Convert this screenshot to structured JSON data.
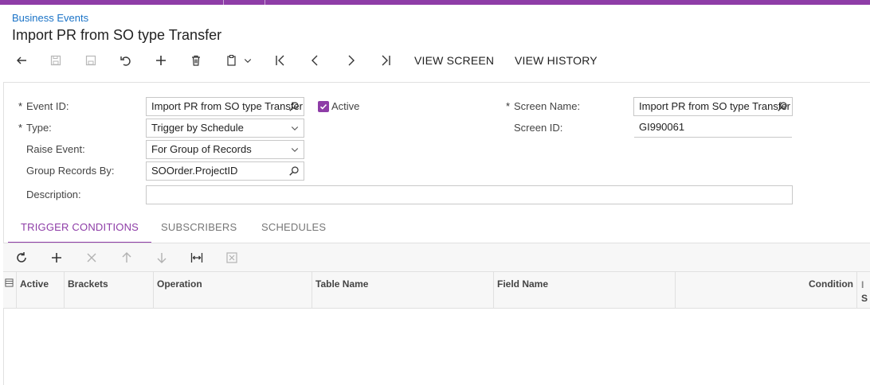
{
  "breadcrumb": "Business Events",
  "title": "Import PR from SO type Transfer",
  "toolbar": {
    "view_screen": "VIEW SCREEN",
    "view_history": "VIEW HISTORY"
  },
  "form": {
    "event_id": {
      "label": "Event ID:",
      "value": "Import PR from SO type Transfer"
    },
    "active": {
      "label": "Active",
      "checked": true
    },
    "screen_name": {
      "label": "Screen Name:",
      "value": "Import PR from SO type Transfer"
    },
    "type": {
      "label": "Type:",
      "value": "Trigger by Schedule"
    },
    "screen_id": {
      "label": "Screen ID:",
      "value": "GI990061"
    },
    "raise_event": {
      "label": "Raise Event:",
      "value": "For Group of Records"
    },
    "group_records_by": {
      "label": "Group Records By:",
      "value": "SOOrder.ProjectID"
    },
    "description": {
      "label": "Description:",
      "value": ""
    }
  },
  "tabs": [
    {
      "label": "TRIGGER CONDITIONS",
      "active": true
    },
    {
      "label": "SUBSCRIBERS",
      "active": false
    },
    {
      "label": "SCHEDULES",
      "active": false
    }
  ],
  "grid": {
    "columns": [
      "Active",
      "Brackets",
      "Operation",
      "Table Name",
      "Field Name",
      "Condition",
      "I",
      "S"
    ]
  },
  "colors": {
    "accent": "#8e3da7",
    "link": "#1a73c7"
  }
}
